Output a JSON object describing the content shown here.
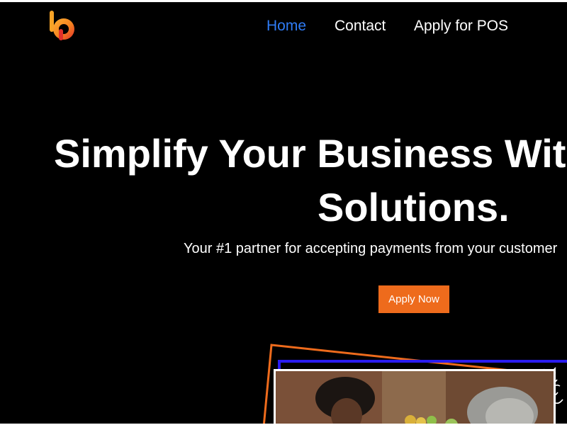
{
  "header": {
    "logo_icon": "bp-logo-icon",
    "nav": [
      {
        "label": "Home",
        "active": true
      },
      {
        "label": "Contact",
        "active": false
      },
      {
        "label": "Apply for POS",
        "active": false
      }
    ]
  },
  "hero": {
    "title_line1": "Simplify Your Business Wit",
    "title_line2": "Solutions.",
    "subtitle": "Your #1 partner for accepting payments from your customer",
    "cta_label": "Apply Now"
  },
  "colors": {
    "background": "#000000",
    "active_link": "#2f7cf6",
    "accent_orange": "#ee6b1c",
    "frame_blue": "#2a1cf0",
    "logo_orange": "#f5821f",
    "logo_red": "#e2302b"
  },
  "media": {
    "photo_icon": "market-vendors-photo",
    "decoration_icon": "wavy-lines-icon"
  }
}
